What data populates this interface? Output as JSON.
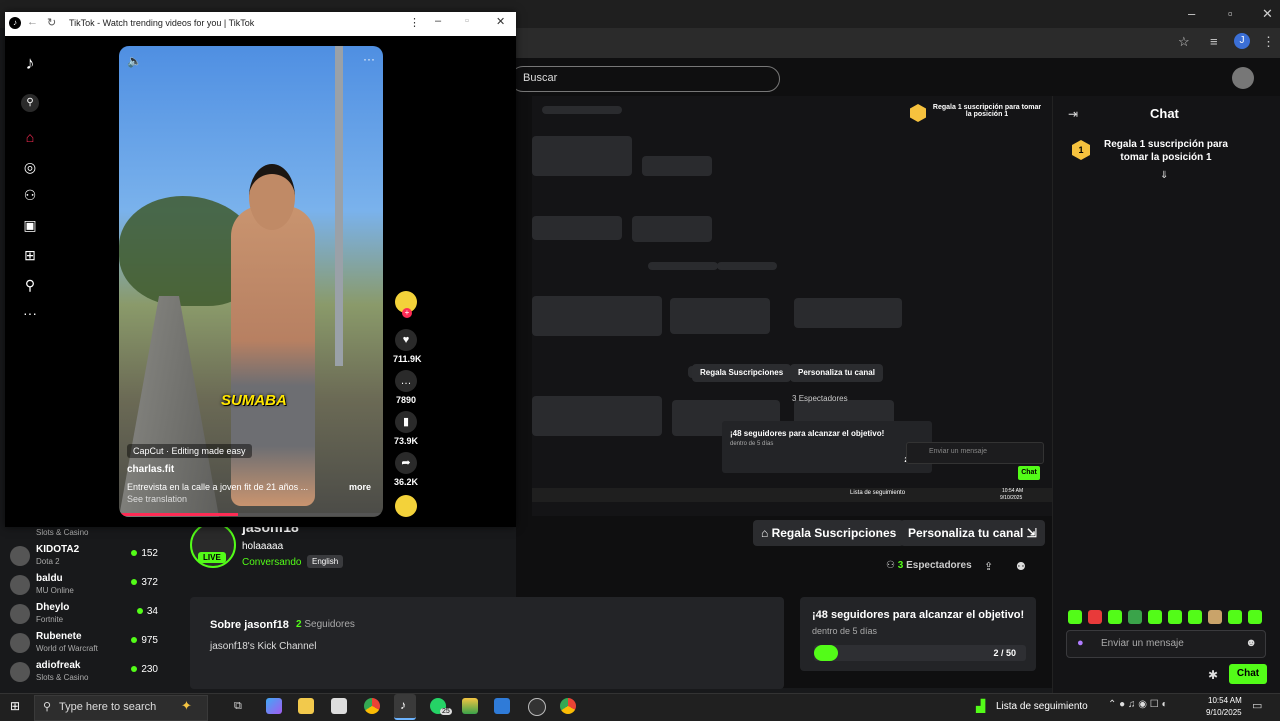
{
  "background_browser": {
    "search_placeholder": "Buscar",
    "chat_title": "Chat",
    "pinned_gift_text": "Regala 1 suscripción para tomar la posición 1",
    "nested_pinned_gift_text": "Regala 1 suscripción para tomar la posición 1",
    "gift_rank": "1"
  },
  "kick_sidebar": {
    "top_partial_game": "Slots & Casino",
    "channels": [
      {
        "name": "KIDOTA2",
        "game": "Dota 2",
        "viewers": "152"
      },
      {
        "name": "baldu",
        "game": "MU Online",
        "viewers": "372"
      },
      {
        "name": "Dheylo",
        "game": "Fortnite",
        "viewers": "34"
      },
      {
        "name": "Rubenete",
        "game": "World of Warcraft",
        "viewers": "975"
      },
      {
        "name": "adiofreak",
        "game": "Slots & Casino",
        "viewers": "230"
      }
    ]
  },
  "stream": {
    "streamer": "jasonf18",
    "title": "holaaaaa",
    "category": "Conversando",
    "language": "English",
    "live_label": "LIVE",
    "gift_subs_button": "Regala Suscripciones",
    "customize_button": "Personaliza tu canal",
    "viewers_count": "3",
    "viewers_label": "Espectadores",
    "about_title": "Sobre jasonf18",
    "followers_count": "2",
    "followers_label": "Seguidores",
    "about_text": "jasonf18's Kick Channel"
  },
  "goal": {
    "title": "¡48 seguidores para alcanzar el objetivo!",
    "subtitle": "dentro de 5 días",
    "progress": "2 / 50",
    "progress_fraction": 0.04
  },
  "chat_input": {
    "placeholder": "Enviar un mensaje",
    "send_label": "Chat"
  },
  "tiktok": {
    "window_title": "TikTok - Watch trending videos for you | TikTok",
    "caption_overlay": "SUMABA",
    "capcut_label": "CapCut · Editing made easy",
    "author": "charlas.fit",
    "description": "Entrevista en la calle a joven fit de 21 años ...",
    "more_label": "more",
    "see_translation": "See translation",
    "likes": "711.9K",
    "comments": "7890",
    "saves": "73.9K",
    "shares": "36.2K",
    "video_progress": 0.45
  },
  "taskbar": {
    "search_placeholder": "Type here to search",
    "whatsapp_badge": "25",
    "tray_app_label": "Lista de seguimiento",
    "time": "10:54 AM",
    "date": "9/10/2025"
  },
  "colors": {
    "kick_green": "#53fc18",
    "tiktok_red": "#fe2c55",
    "gift_gold": "#f6c23e"
  }
}
